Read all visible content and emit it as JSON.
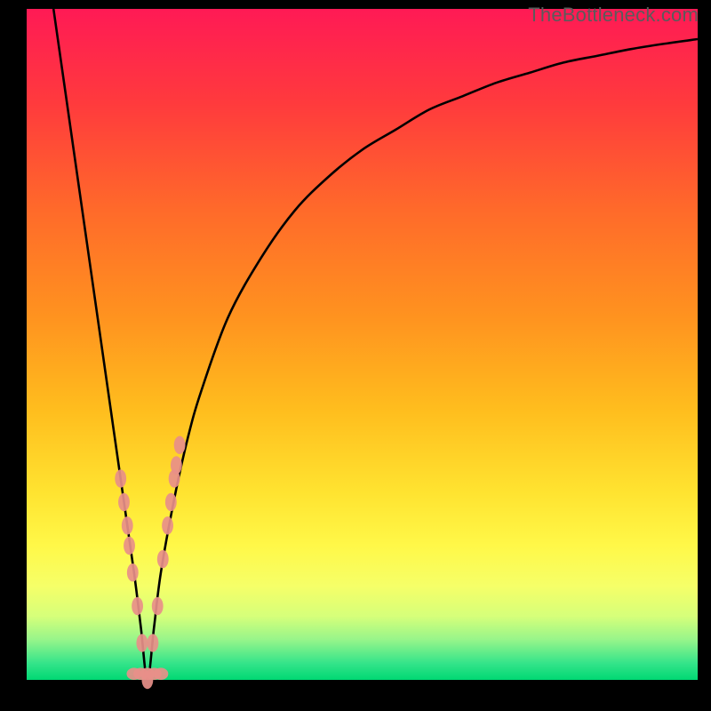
{
  "watermark": "TheBottleneck.com",
  "colors": {
    "black": "#000000",
    "curve": "#000000",
    "marker_fill": "#e88f89",
    "marker_stroke": "#e88f89",
    "gradient_stops": [
      {
        "offset": 0.0,
        "color": "#ff1a55"
      },
      {
        "offset": 0.14,
        "color": "#ff3a3d"
      },
      {
        "offset": 0.3,
        "color": "#ff6a2a"
      },
      {
        "offset": 0.46,
        "color": "#ff931f"
      },
      {
        "offset": 0.6,
        "color": "#ffbe1e"
      },
      {
        "offset": 0.72,
        "color": "#ffe330"
      },
      {
        "offset": 0.8,
        "color": "#fff848"
      },
      {
        "offset": 0.86,
        "color": "#f6ff68"
      },
      {
        "offset": 0.905,
        "color": "#d6ff7a"
      },
      {
        "offset": 0.94,
        "color": "#97f58a"
      },
      {
        "offset": 0.975,
        "color": "#35e48a"
      },
      {
        "offset": 1.0,
        "color": "#00d873"
      }
    ]
  },
  "chart_data": {
    "type": "line",
    "title": "",
    "xlabel": "",
    "ylabel": "",
    "xlim": [
      0,
      100
    ],
    "ylim": [
      0,
      100
    ],
    "x_of_min": 18,
    "series": [
      {
        "name": "bottleneck-curve",
        "x": [
          4,
          6,
          8,
          10,
          12,
          14,
          16,
          17,
          18,
          19,
          20,
          22,
          24,
          26,
          30,
          35,
          40,
          45,
          50,
          55,
          60,
          65,
          70,
          75,
          80,
          85,
          90,
          95,
          100
        ],
        "y": [
          100,
          86,
          72,
          58,
          44,
          30,
          16,
          8,
          0,
          8,
          16,
          27,
          36,
          43,
          54,
          63,
          70,
          75,
          79,
          82,
          85,
          87,
          89,
          90.5,
          92,
          93,
          94,
          94.8,
          95.5
        ]
      }
    ],
    "markers": {
      "name": "highlighted-points",
      "x": [
        14.0,
        14.5,
        15.0,
        15.3,
        15.8,
        16.5,
        17.2,
        18.0,
        18.8,
        19.5,
        20.3,
        21.0,
        21.5,
        22.0,
        22.3,
        22.8
      ],
      "y": [
        30.0,
        26.5,
        23.0,
        20.0,
        16.0,
        11.0,
        5.5,
        0.0,
        5.5,
        11.0,
        18.0,
        23.0,
        26.5,
        30.0,
        32.0,
        35.0
      ]
    },
    "baseline_markers": {
      "x": [
        16.0,
        17.0,
        18.0,
        19.0,
        20.0
      ],
      "y": [
        0,
        0,
        0,
        0,
        0
      ]
    }
  }
}
